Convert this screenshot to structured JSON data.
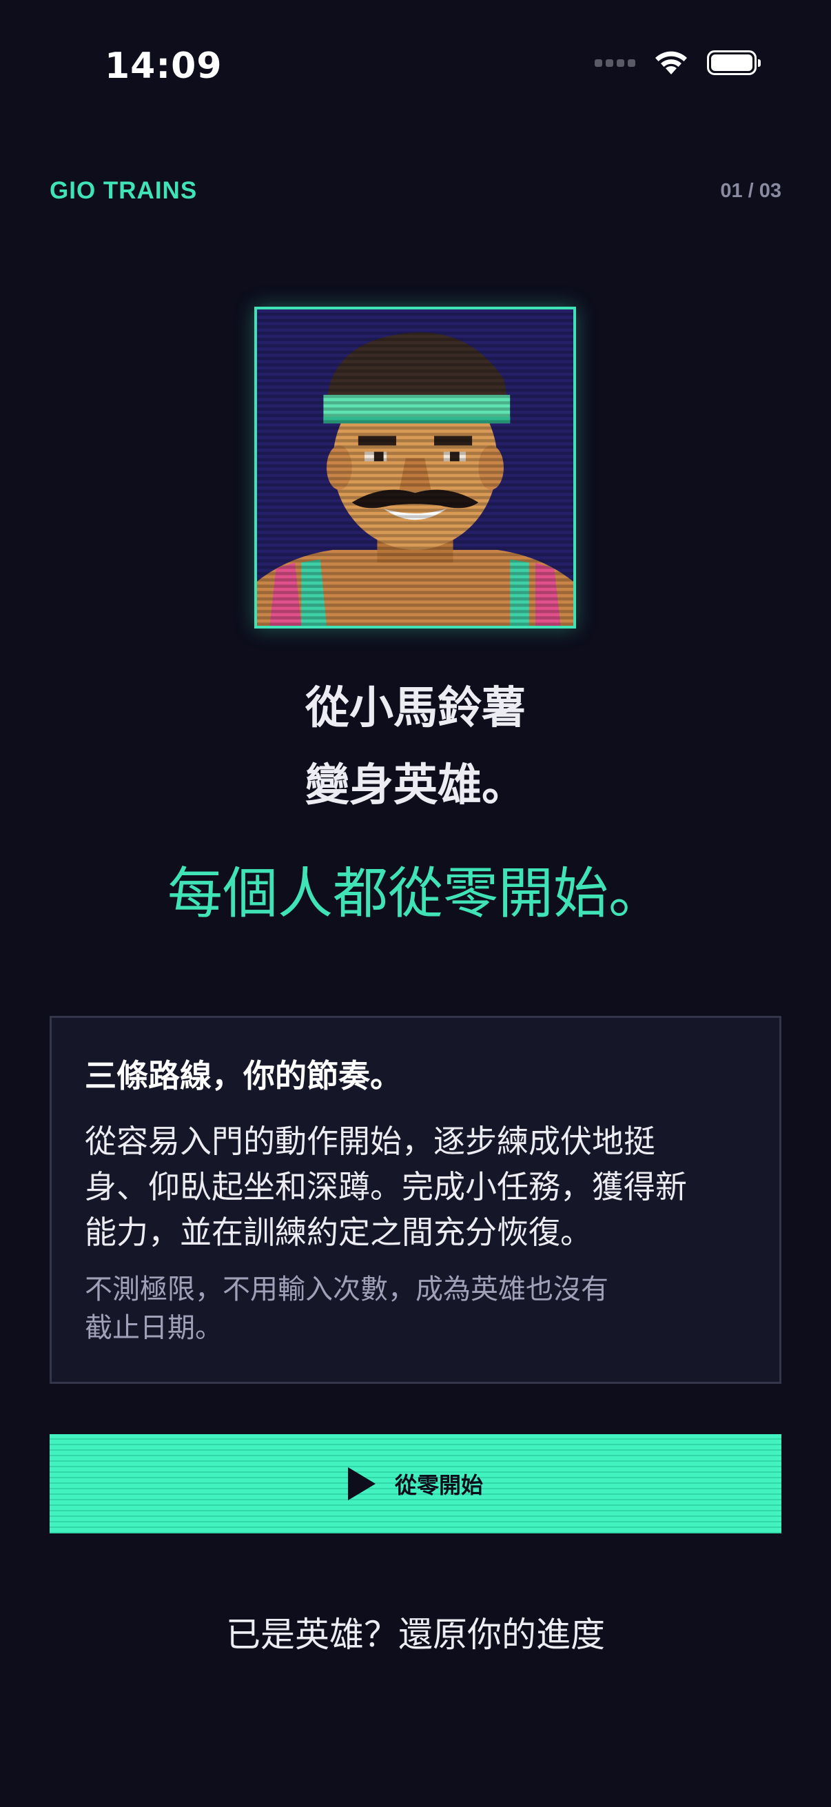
{
  "status_bar": {
    "time": "14:09"
  },
  "header": {
    "brand": "GIO TRAINS",
    "pager": "01 / 03"
  },
  "hero": {
    "portrait_icon": "pixel-art-hero-portrait",
    "headline_line1": "從小馬鈴薯",
    "headline_line2": "變身英雄。",
    "tagline": "每個人都從零開始。"
  },
  "card": {
    "title": "三條路線，你的節奏。",
    "body_lines": [
      "從容易入門的動作開始，逐步練成伏地挺",
      "身、仰臥起坐和深蹲。完成小任務，獲得新",
      "能力，並在訓練約定之間充分恢復。"
    ],
    "note_lines": [
      "不測極限，不用輸入次數，成為英雄也沒有",
      "截止日期。"
    ]
  },
  "cta": {
    "label": "從零開始",
    "icon": "play-icon"
  },
  "restore_link": "已是英雄？還原你的進度",
  "colors": {
    "accent": "#3fe3b5",
    "background": "#0d0d1c",
    "card": "#161629"
  }
}
